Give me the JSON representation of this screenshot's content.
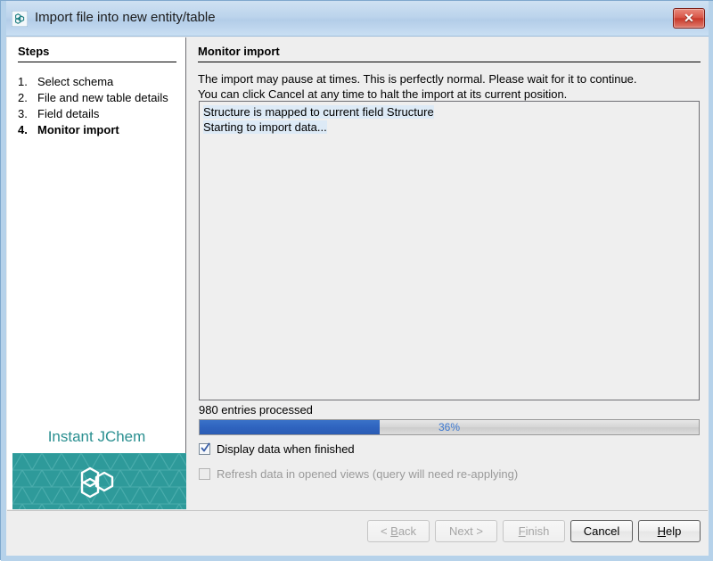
{
  "window": {
    "title": "Import file into new entity/table",
    "icon": "molecule-hexagon-icon",
    "close_label": "✕"
  },
  "sidebar": {
    "heading": "Steps",
    "items": [
      {
        "num": "1.",
        "label": "Select schema",
        "current": false
      },
      {
        "num": "2.",
        "label": "File and new table details",
        "current": false
      },
      {
        "num": "3.",
        "label": "Field details",
        "current": false
      },
      {
        "num": "4.",
        "label": "Monitor import",
        "current": true
      }
    ],
    "brand_name": "Instant JChem",
    "brand_color": "#2e9a9a",
    "brand_text_color": "#2a8f90"
  },
  "main": {
    "heading": "Monitor import",
    "description": [
      "The import may pause at times. This is perfectly normal. Please wait for it to continue.",
      "You can click Cancel at any time to halt the import at its current position."
    ],
    "log": [
      "Structure is mapped to current field Structure",
      "Starting to import data..."
    ],
    "progress": {
      "status_text": "980 entries processed",
      "percent_label": "36%",
      "percent_value": 36,
      "fill_color": "#2f64bf",
      "text_color": "#3c78d0"
    },
    "options": [
      {
        "label": "Display data when finished",
        "checked": true,
        "disabled": false
      },
      {
        "label": "Refresh data in opened views (query will need re-applying)",
        "checked": false,
        "disabled": true
      }
    ]
  },
  "buttons": [
    {
      "key": "back",
      "label": "< Back",
      "mnemonic": "B",
      "disabled": true,
      "emphasis": false
    },
    {
      "key": "next",
      "label": "Next >",
      "mnemonic": "",
      "disabled": true,
      "emphasis": false
    },
    {
      "key": "finish",
      "label": "Finish",
      "mnemonic": "F",
      "disabled": true,
      "emphasis": false
    },
    {
      "key": "cancel",
      "label": "Cancel",
      "mnemonic": "",
      "disabled": false,
      "emphasis": true
    },
    {
      "key": "help",
      "label": "Help",
      "mnemonic": "H",
      "disabled": false,
      "emphasis": true
    }
  ]
}
